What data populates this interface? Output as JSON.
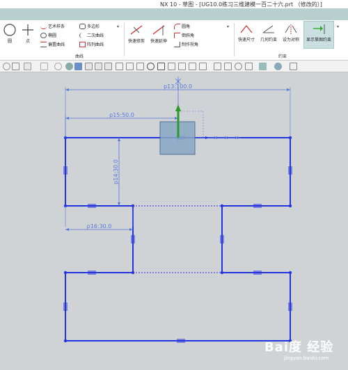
{
  "window": {
    "title": "NX 10 - 草图 - [UG10.0练习三维建模一百二十六.prt （修改的）]"
  },
  "ribbon": {
    "circle_label": "圆",
    "point_label": "点",
    "curve_items": [
      "艺术样条",
      "椭圆",
      "偏置曲线"
    ],
    "curve_items2": [
      "多边形",
      "二次曲线",
      "阵列曲线"
    ],
    "edit_items": [
      "快速修剪",
      "快速延伸"
    ],
    "corner_items": [
      "圆角",
      "倒斜角",
      "制作拐角"
    ],
    "constraint_items": [
      "快速尺寸",
      "几何约束",
      "设为对称",
      "显示草图约束"
    ],
    "group_curve": "曲线",
    "group_constraint": "约束"
  },
  "toolbar": {
    "icons": [
      "snap-icon",
      "filter-icon",
      "select-icon",
      "shade-icon",
      "wire-icon",
      "line-icon",
      "arc-icon",
      "tangent-icon",
      "perp-icon",
      "circle-center-icon",
      "grid-icon",
      "point-icon",
      "slash-icon",
      "view-icon",
      "layer-icon",
      "render-icon",
      "camera-icon"
    ]
  },
  "sketch": {
    "dims": {
      "p13": "p13:100.0",
      "p15": "p15:50.0",
      "p14": "p14:30.0",
      "p16": "p16:30.0"
    },
    "line_color": "#2233dd",
    "dim_color": "#5577dd"
  },
  "watermark": {
    "brand": "Bai度 经验",
    "url": "jingyan.baidu.com"
  }
}
